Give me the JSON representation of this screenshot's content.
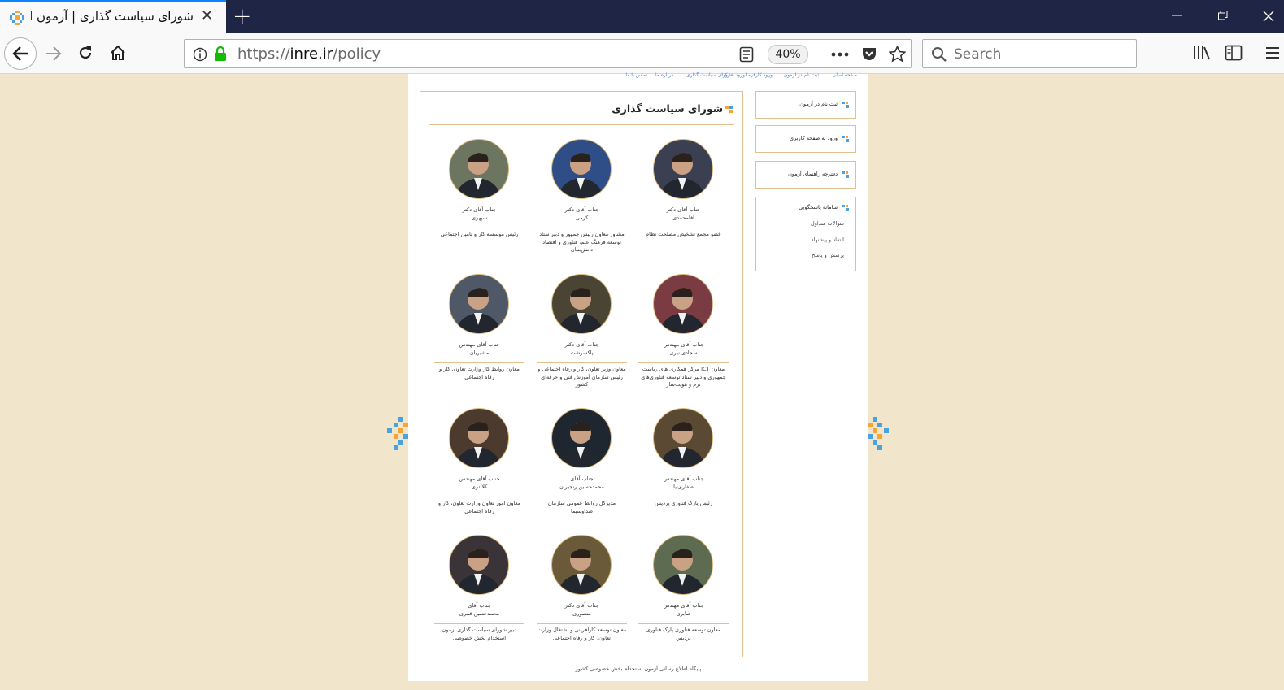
{
  "browser": {
    "tab_title": "شورای سیاست گذاری | آزمون استخدامی بخش خصوصی",
    "url_prefix": "https://",
    "url_domain": "inre.ir",
    "url_path": "/policy",
    "zoom": "40%",
    "search_placeholder": "Search"
  },
  "site": {
    "top_menu": [
      "صفحه اصلی",
      "ثبت نام در آزمون",
      "ورود کارفرما",
      "ورود شرکت",
      "شورای سیاست گذاری",
      "درباره ما",
      "تماس با ما"
    ],
    "section_title": "شورای سیاست گذاری",
    "members": [
      {
        "honor": "جناب آقای دکتر",
        "name": "آقامحمدی",
        "role": "عضو مجمع تشخیص مصلحت نظام"
      },
      {
        "honor": "جناب آقای دکتر",
        "name": "کرمی",
        "role": "مشاور معاون رئیس جمهور و دبیر ستاد توسعه فرهنگ علم، فناوری و اقتصاد دانش‌بنیان"
      },
      {
        "honor": "جناب آقای دکتر",
        "name": "سپهری",
        "role": "رئیس موسسه کار و تامین اجتماعی"
      },
      {
        "honor": "جناب آقای مهندس",
        "name": "سجادی نیری",
        "role": "معاون ICT مرکز همکاری های ریاست جمهوری و دبیر ستاد توسعه فناوری‌های نرم و هویت‌ساز"
      },
      {
        "honor": "جناب آقای دکتر",
        "name": "پاکسرشت",
        "role": "معاون وزیر تعاون، کار و رفاه اجتماعی و رئیس سازمان آموزش فنی و حرفه‌ای کشور"
      },
      {
        "honor": "جناب آقای مهندس",
        "name": "مشیریان",
        "role": "معاون روابط کار وزارت تعاون، کار و رفاه اجتماعی"
      },
      {
        "honor": "جناب آقای مهندس",
        "name": "صفاری‌نیا",
        "role": "رئیس پارک فناوری پردیس"
      },
      {
        "honor": "جناب آقای",
        "name": "محمدحسین رنجبران",
        "role": "مدیرکل روابط عمومی سازمان صداوسیما"
      },
      {
        "honor": "جناب آقای مهندس",
        "name": "کلانتری",
        "role": "معاون امور تعاون وزارت تعاون، کار و رفاه اجتماعی"
      },
      {
        "honor": "جناب آقای مهندس",
        "name": "صابری",
        "role": "معاون توسعه فناوری پارک فناوری پردیس"
      },
      {
        "honor": "جناب آقای دکتر",
        "name": "منصوری",
        "role": "معاون توسعه کارآفرینی و اشتغال وزارت تعاون، کار و رفاه اجتماعی"
      },
      {
        "honor": "جناب آقای",
        "name": "محمدحسین قمری",
        "role": "دبیر شورای سیاست گذاری آزمون استخدام بخش خصوصی"
      }
    ],
    "sidebar": {
      "register": "ثبت نام در آزمون",
      "login": "ورود به صفحه کاربری",
      "guide": "دفترچه راهنمای آزمون",
      "support_title": "سامانه پاسخگویی",
      "support_items": [
        "سوالات متداول",
        "انتقاد و پیشنهاد",
        "پرسش و پاسخ"
      ]
    },
    "footer": "پایگاه اطلاع رسانی آزمون استخدام بخش خصوصی کشور"
  },
  "colors": {
    "accent": "#e3c08b",
    "page_bg": "#f1e6cb",
    "titlebar": "#1f2544",
    "link": "#4a7cc2"
  }
}
